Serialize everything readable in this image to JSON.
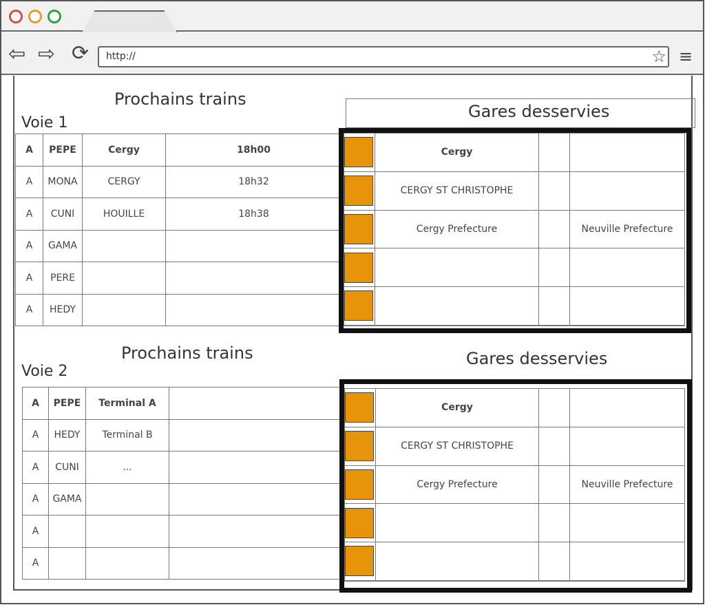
{
  "browser": {
    "url": "http://",
    "colors": {
      "close": "#d05050",
      "minimize": "#e0a030",
      "maximize": "#30a040"
    }
  },
  "section1": {
    "title": "Prochains trains",
    "track": "Voie 1",
    "trains": [
      [
        "A",
        "PEPE",
        "Cergy",
        "18h00"
      ],
      [
        "A",
        "MONA",
        "CERGY",
        "18h32"
      ],
      [
        "A",
        "CUNI",
        "HOUILLE",
        "18h38"
      ],
      [
        "A",
        "GAMA",
        "",
        ""
      ],
      [
        "A",
        "PERE",
        "",
        ""
      ],
      [
        "A",
        "HEDY",
        "",
        ""
      ]
    ],
    "stations_title": "Gares desservies",
    "stations": [
      [
        "Cergy",
        "",
        ""
      ],
      [
        "CERGY ST CHRISTOPHE",
        "",
        ""
      ],
      [
        "Cergy Prefecture",
        "",
        "Neuville Prefecture"
      ],
      [
        "",
        "",
        ""
      ],
      [
        "",
        "",
        ""
      ],
      [
        "",
        "",
        ""
      ]
    ]
  },
  "section2": {
    "title": "Prochains trains",
    "track": "Voie 2",
    "trains": [
      [
        "A",
        "PEPE",
        "Terminal A",
        ""
      ],
      [
        "A",
        "HEDY",
        "Terminal B",
        ""
      ],
      [
        "A",
        "CUNI",
        "...",
        ""
      ],
      [
        "A",
        "GAMA",
        "",
        ""
      ],
      [
        "A",
        "",
        "",
        ""
      ],
      [
        "A",
        "",
        "",
        ""
      ]
    ],
    "stations_title": "Gares desservies",
    "stations": [
      [
        "Cergy",
        "",
        ""
      ],
      [
        "CERGY ST CHRISTOPHE",
        "",
        ""
      ],
      [
        "Cergy Prefecture",
        "",
        "Neuville Prefecture"
      ],
      [
        "",
        "",
        ""
      ],
      [
        "",
        "",
        ""
      ],
      [
        "",
        "",
        ""
      ]
    ]
  },
  "accent_color": "#e8940a"
}
